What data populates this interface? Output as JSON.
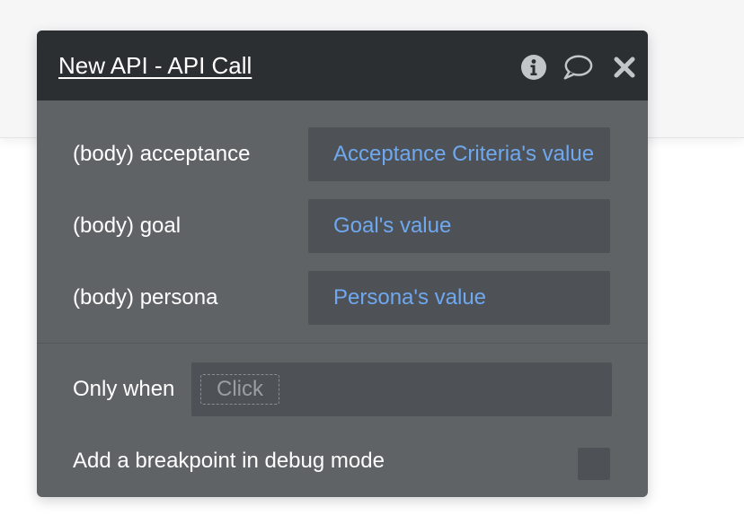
{
  "panel": {
    "title": "New API - API Call",
    "icons": {
      "info": "info-circle-icon",
      "comment": "speech-bubble-icon",
      "close": "close-icon"
    }
  },
  "params": [
    {
      "label": "(body) acceptance",
      "value": "Acceptance Criteria's value"
    },
    {
      "label": "(body) goal",
      "value": "Goal's value"
    },
    {
      "label": "(body) persona",
      "value": "Persona's value"
    }
  ],
  "condition": {
    "label": "Only when",
    "placeholder": "Click"
  },
  "debug": {
    "label": "Add a breakpoint in debug mode",
    "checked": false
  },
  "colors": {
    "header_bg": "#2b2f32",
    "panel_bg": "#5f6366",
    "field_bg": "#4e5256",
    "value_text": "#6fa8ef"
  }
}
